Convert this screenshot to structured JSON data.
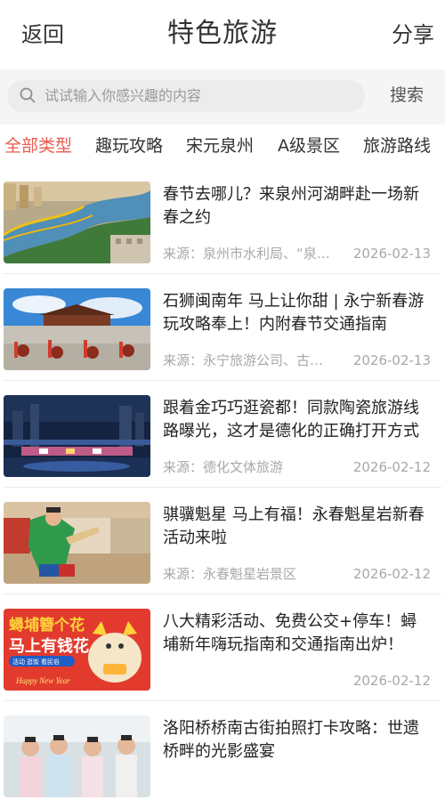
{
  "header": {
    "back_label": "返回",
    "title": "特色旅游",
    "share_label": "分享"
  },
  "search": {
    "placeholder": "试试输入你感兴趣的内容",
    "button_label": "搜索"
  },
  "tabs": [
    {
      "label": "全部类型",
      "active": true
    },
    {
      "label": "趣玩攻略",
      "active": false
    },
    {
      "label": "宋元泉州",
      "active": false
    },
    {
      "label": "A级景区",
      "active": false
    },
    {
      "label": "旅游路线",
      "active": false
    }
  ],
  "articles": [
    {
      "title": "春节去哪儿？来泉州河湖畔赴一场新春之约",
      "source": "来源：泉州市水利局、“泉…",
      "date": "2026-02-13"
    },
    {
      "title": "石狮闽南年 马上让你甜 | 永宁新春游玩攻略奉上！内附春节交通指南",
      "source": "来源：永宁旅游公司、古…",
      "date": "2026-02-13"
    },
    {
      "title": "跟着金巧巧逛瓷都！同款陶瓷旅游线路曝光，这才是德化的正确打开方式",
      "source": "来源：德化文体旅游",
      "date": "2026-02-12"
    },
    {
      "title": "骐骥魁星 马上有福！永春魁星岩新春活动来啦",
      "source": "来源：永春魁星岩景区",
      "date": "2026-02-12"
    },
    {
      "title": "八大精彩活动、免费公交+停车！蟳埔新年嗨玩指南和交通指南出炉！",
      "source": "",
      "date": "2026-02-12"
    },
    {
      "title": "洛阳桥桥南古街拍照打卡攻略：世遗桥畔的光影盛宴",
      "source": "",
      "date": ""
    }
  ],
  "thumb_texts": {
    "poster_line1": "蟳埔簪个花",
    "poster_line2": "马上有钱花",
    "poster_tag": "活动 逛街 看民俗",
    "poster_greeting": "Happy New Year"
  },
  "colors": {
    "accent": "#ea5a4f",
    "text": "#222222",
    "muted": "#a8a8a8"
  }
}
